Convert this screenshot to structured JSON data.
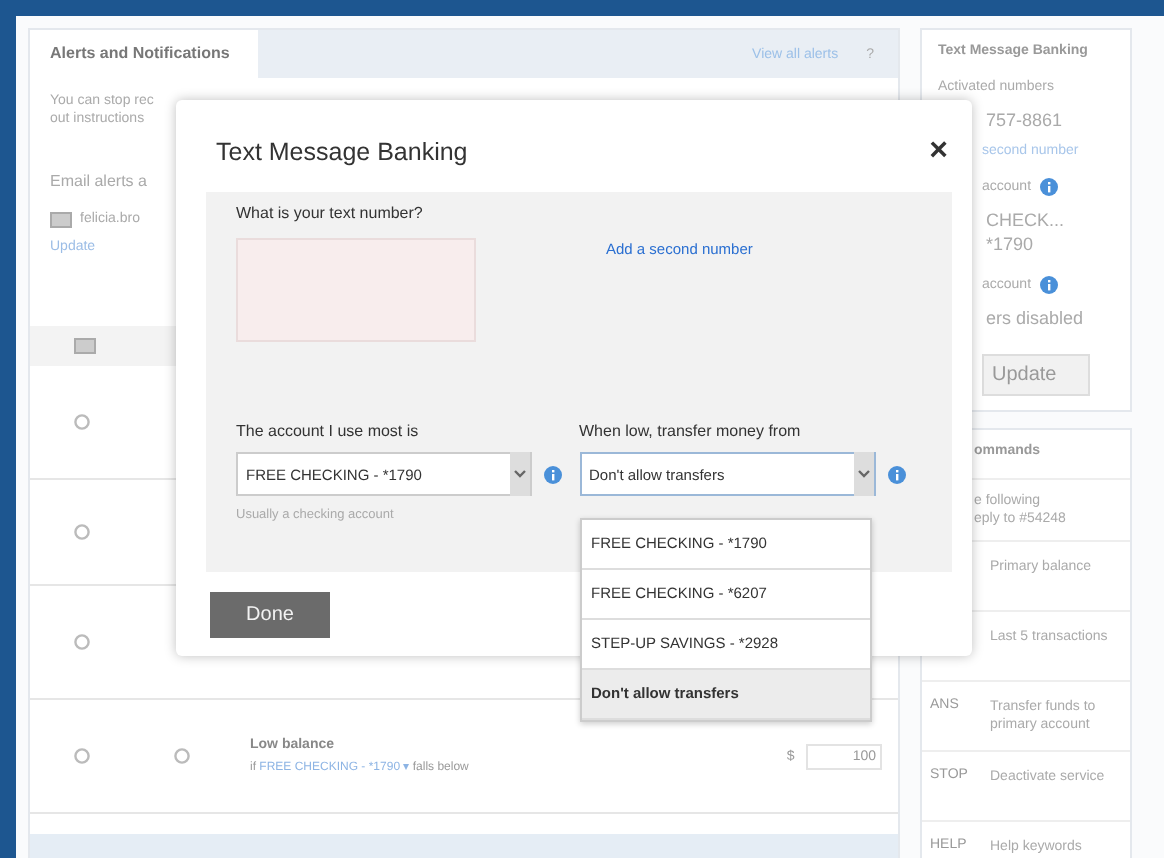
{
  "alerts": {
    "title": "Alerts and Notifications",
    "view_all": "View all alerts",
    "help": "?",
    "intro": [
      "You can stop rec",
      "out instructions"
    ],
    "email_label": "Email alerts a",
    "email_value": "felicia.bro",
    "update": "Update",
    "rows": [
      {
        "kind": "blank"
      },
      {
        "kind": "blank"
      },
      {
        "kind": "blank"
      },
      {
        "kind": "low",
        "title": "Low balance",
        "prefix": "if ",
        "account": "FREE CHECKING - *1790 ▾",
        "suffix": " falls below",
        "currency": "$",
        "amount": "100"
      }
    ]
  },
  "sidebar": {
    "title": "Text Message Banking",
    "activated_label": "Activated numbers",
    "number": "757-8861",
    "add": "second number",
    "settings": [
      {
        "label": "account",
        "value": "CHECK... *1790"
      },
      {
        "label": "account",
        "value": "ers disabled"
      }
    ],
    "update": "Update"
  },
  "commands": {
    "title": "ommands",
    "intro": [
      "e following",
      "eply to #54248"
    ],
    "items": [
      {
        "desc": "Primary balance"
      },
      {
        "desc": "Last 5 transactions"
      },
      {
        "keyword": "ANS",
        "desc": "Transfer funds to primary account"
      },
      {
        "keyword": "STOP",
        "desc": "Deactivate service"
      },
      {
        "keyword": "HELP",
        "desc": "Help keywords"
      }
    ]
  },
  "modal": {
    "title": "Text Message Banking",
    "close": "×",
    "question": "What is your text number?",
    "add_link": "Add a second number",
    "primary": {
      "label": "The account I use most is",
      "value": "FREE CHECKING - *1790",
      "hint": "Usually a checking account"
    },
    "transfer": {
      "label": "When low, transfer money from",
      "value": "Don't allow transfers",
      "open": true,
      "options": [
        {
          "label": "FREE CHECKING - *1790",
          "selected": false
        },
        {
          "label": "FREE CHECKING - *6207",
          "selected": false
        },
        {
          "label": "STEP-UP SAVINGS - *2928",
          "selected": false
        },
        {
          "label": "Don't allow transfers",
          "selected": true
        }
      ]
    },
    "done": "Done"
  }
}
